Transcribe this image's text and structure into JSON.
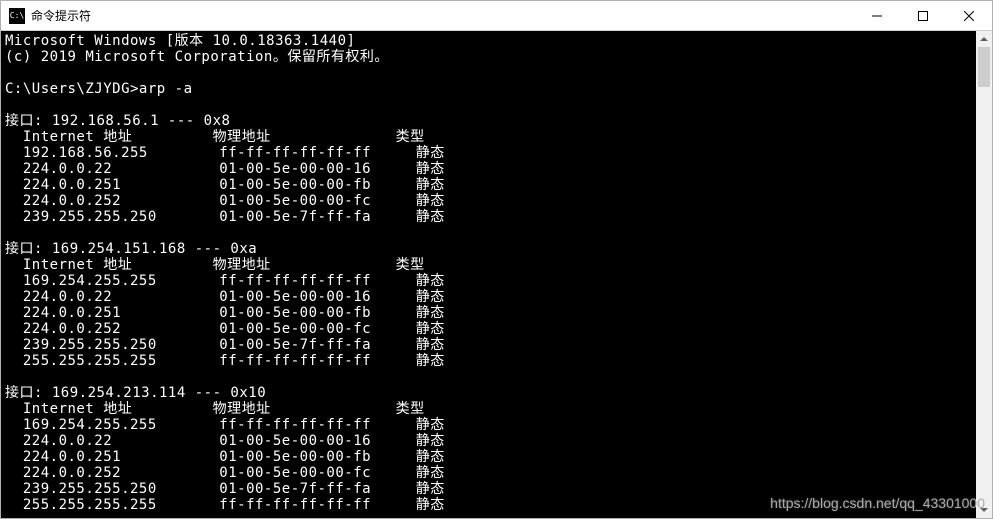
{
  "window": {
    "title": "命令提示符",
    "icon_label": "C:\\"
  },
  "header": {
    "line1": "Microsoft Windows [版本 10.0.18363.1440]",
    "line2": "(c) 2019 Microsoft Corporation。保留所有权利。"
  },
  "prompt_line": "C:\\Users\\ZJYDG>arp -a",
  "col_headers": {
    "internet": "Internet 地址",
    "physical": "物理地址",
    "type": "类型"
  },
  "interfaces": [
    {
      "header": "接口: 192.168.56.1 --- 0x8",
      "rows": [
        {
          "ip": "192.168.56.255",
          "mac": "ff-ff-ff-ff-ff-ff",
          "type": "静态"
        },
        {
          "ip": "224.0.0.22",
          "mac": "01-00-5e-00-00-16",
          "type": "静态"
        },
        {
          "ip": "224.0.0.251",
          "mac": "01-00-5e-00-00-fb",
          "type": "静态"
        },
        {
          "ip": "224.0.0.252",
          "mac": "01-00-5e-00-00-fc",
          "type": "静态"
        },
        {
          "ip": "239.255.255.250",
          "mac": "01-00-5e-7f-ff-fa",
          "type": "静态"
        }
      ]
    },
    {
      "header": "接口: 169.254.151.168 --- 0xa",
      "rows": [
        {
          "ip": "169.254.255.255",
          "mac": "ff-ff-ff-ff-ff-ff",
          "type": "静态"
        },
        {
          "ip": "224.0.0.22",
          "mac": "01-00-5e-00-00-16",
          "type": "静态"
        },
        {
          "ip": "224.0.0.251",
          "mac": "01-00-5e-00-00-fb",
          "type": "静态"
        },
        {
          "ip": "224.0.0.252",
          "mac": "01-00-5e-00-00-fc",
          "type": "静态"
        },
        {
          "ip": "239.255.255.250",
          "mac": "01-00-5e-7f-ff-fa",
          "type": "静态"
        },
        {
          "ip": "255.255.255.255",
          "mac": "ff-ff-ff-ff-ff-ff",
          "type": "静态"
        }
      ]
    },
    {
      "header": "接口: 169.254.213.114 --- 0x10",
      "rows": [
        {
          "ip": "169.254.255.255",
          "mac": "ff-ff-ff-ff-ff-ff",
          "type": "静态"
        },
        {
          "ip": "224.0.0.22",
          "mac": "01-00-5e-00-00-16",
          "type": "静态"
        },
        {
          "ip": "224.0.0.251",
          "mac": "01-00-5e-00-00-fb",
          "type": "静态"
        },
        {
          "ip": "224.0.0.252",
          "mac": "01-00-5e-00-00-fc",
          "type": "静态"
        },
        {
          "ip": "239.255.255.250",
          "mac": "01-00-5e-7f-ff-fa",
          "type": "静态"
        },
        {
          "ip": "255.255.255.255",
          "mac": "ff-ff-ff-ff-ff-ff",
          "type": "静态"
        }
      ]
    }
  ],
  "watermark": "https://blog.csdn.net/qq_43301000"
}
